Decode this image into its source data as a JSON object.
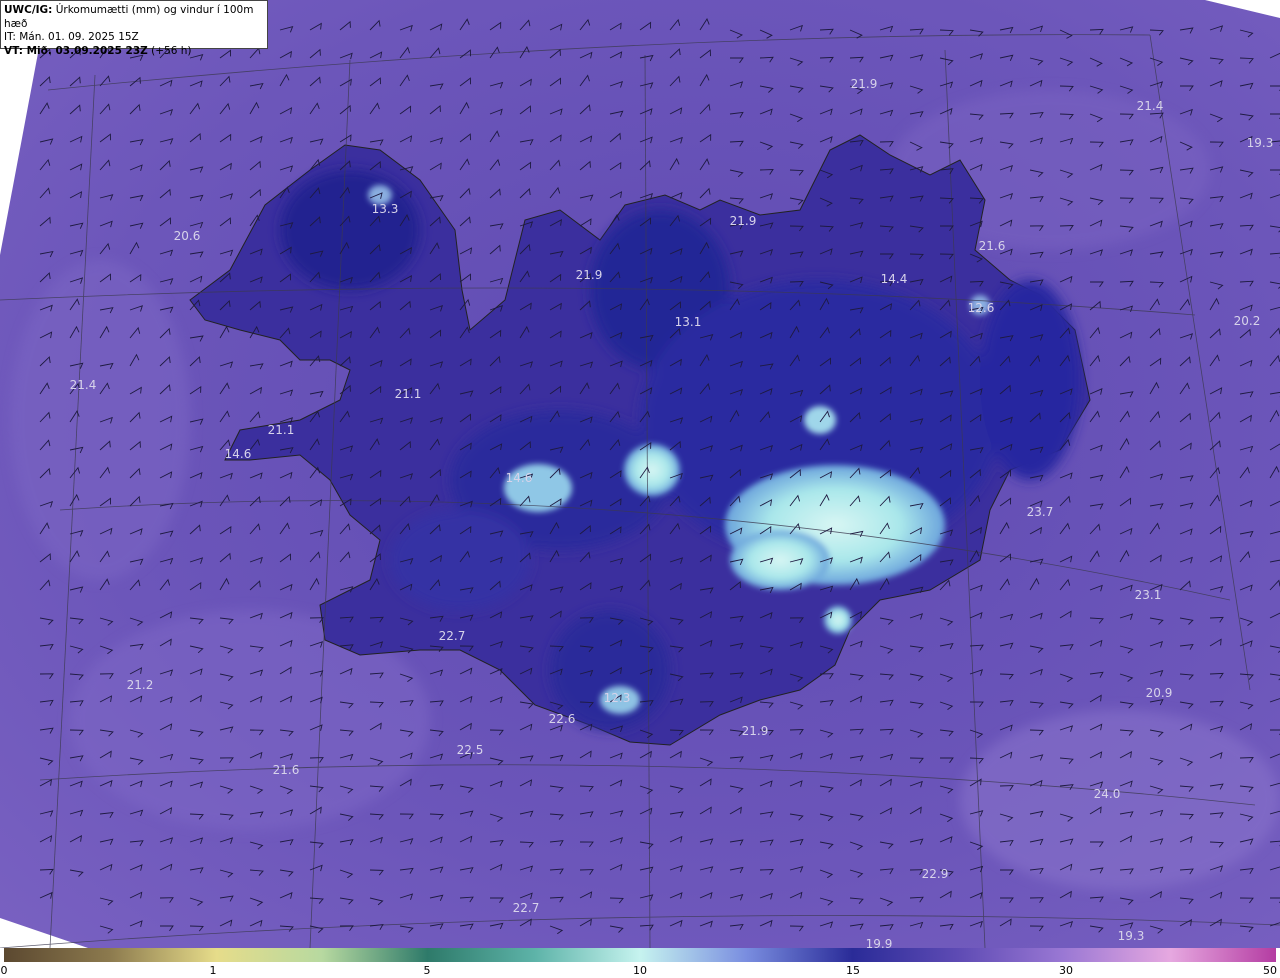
{
  "header": {
    "line1_bold": "UWC/IG:",
    "line1_rest": " Úrkomumætti (mm) og vindur í 100m hæð",
    "line2": "IT: Mán. 01. 09. 2025 15Z",
    "line3_bold": "VT: Mið. 03.09.2025 23Z",
    "line3_rest": " (+56 h)"
  },
  "colors": {
    "background_purple": "#6a54b6",
    "dark_blue": "#27248f",
    "pale_cyan": "#c9f1ef",
    "coast": "#222222"
  },
  "map_labels": [
    "21.9",
    "21.4",
    "19.3",
    "13.3",
    "20.6",
    "21.9",
    "21.9",
    "21.6",
    "14.4",
    "12.6",
    "13.1",
    "20.2",
    "21.4",
    "21.1",
    "21.1",
    "14.6",
    "14.6",
    "23.7",
    "23.1",
    "22.7",
    "21.2",
    "12.3",
    "22.6",
    "21.9",
    "20.9",
    "22.5",
    "21.6",
    "24.0",
    "22.9",
    "22.7",
    "19.9",
    "19.3"
  ],
  "colorbar": {
    "ticks": [
      "0",
      "1",
      "5",
      "10",
      "15",
      "30",
      "50"
    ],
    "colors": [
      "#5b4830",
      "#8c7a4e",
      "#e6dc8a",
      "#b7d9a0",
      "#2e7a6a",
      "#5db3a8",
      "#c6f3ef",
      "#7a8ee0",
      "#2a2b98",
      "#5e4bb4",
      "#9a78d4",
      "#e6a8e0",
      "#b43ca2"
    ]
  }
}
